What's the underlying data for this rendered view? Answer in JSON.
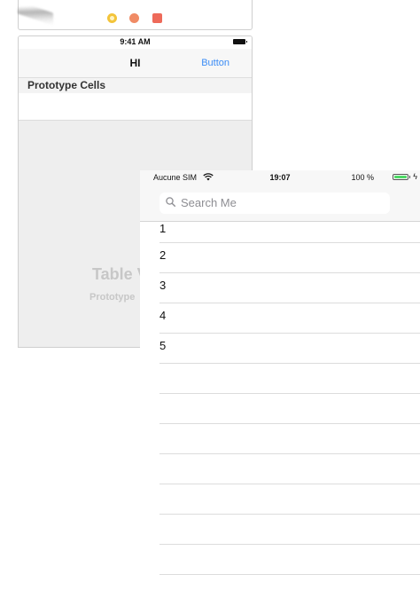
{
  "storyboard": {
    "status_time": "9:41 AM",
    "nav_title": "HI",
    "nav_button": "Button",
    "section_title": "Prototype Cells",
    "table_view_title": "Table V",
    "table_view_subtitle": "Prototype"
  },
  "simulator": {
    "status": {
      "carrier": "Aucune SIM",
      "time": "19:07",
      "battery_percent": "100 %",
      "battery_level": 1.0
    },
    "search": {
      "placeholder": "Search Me"
    },
    "rows": [
      "1",
      "2",
      "3",
      "4",
      "5",
      "",
      "",
      "",
      "",
      "",
      "",
      ""
    ]
  },
  "colors": {
    "tint": "#3b8cf6",
    "battery_green": "#4cd964",
    "separator": "#dcdcdc"
  }
}
